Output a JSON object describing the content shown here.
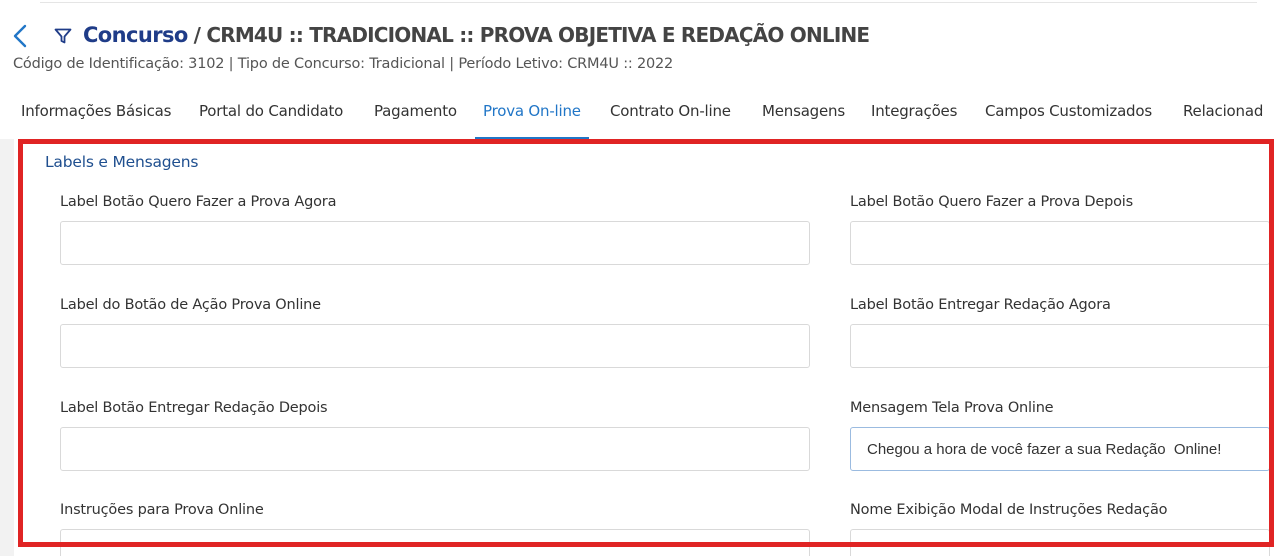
{
  "header": {
    "back_icon": "chevron-left-icon",
    "filter_icon": "filter-icon",
    "title": "Concurso",
    "path": "/ CRM4U :: TRADICIONAL :: PROVA OBJETIVA E REDAÇÃO ONLINE",
    "subtitle": "Código de Identificação: 3102 | Tipo de Concurso: Tradicional | Período Letivo: CRM4U :: 2022"
  },
  "tabs": [
    {
      "label": "Informações Básicas",
      "active": false
    },
    {
      "label": "Portal do Candidato",
      "active": false
    },
    {
      "label": "Pagamento",
      "active": false
    },
    {
      "label": "Prova On-line",
      "active": true
    },
    {
      "label": "Contrato On-line",
      "active": false
    },
    {
      "label": "Mensagens",
      "active": false
    },
    {
      "label": "Integrações",
      "active": false
    },
    {
      "label": "Campos Customizados",
      "active": false
    },
    {
      "label": "Relacionad",
      "active": false
    }
  ],
  "section": {
    "title": "Labels e Mensagens"
  },
  "fields": [
    {
      "label": "Label Botão Quero Fazer a Prova Agora",
      "value": ""
    },
    {
      "label": "Label Botão Quero Fazer a Prova Depois",
      "value": ""
    },
    {
      "label": "Label do Botão de Ação Prova Online",
      "value": ""
    },
    {
      "label": "Label Botão Entregar Redação Agora",
      "value": ""
    },
    {
      "label": "Label Botão Entregar Redação Depois",
      "value": ""
    },
    {
      "label": "Mensagem Tela Prova Online",
      "value": "Chegou a hora de você fazer a sua Redação  Online!"
    },
    {
      "label": "Instruções para Prova Online",
      "value": ""
    },
    {
      "label": "Nome Exibição Modal de Instruções Redação",
      "value": ""
    }
  ],
  "colors": {
    "accent": "#2176c7",
    "title": "#1f3c88",
    "highlight": "#e02424",
    "section_title": "#1f4f8f"
  }
}
